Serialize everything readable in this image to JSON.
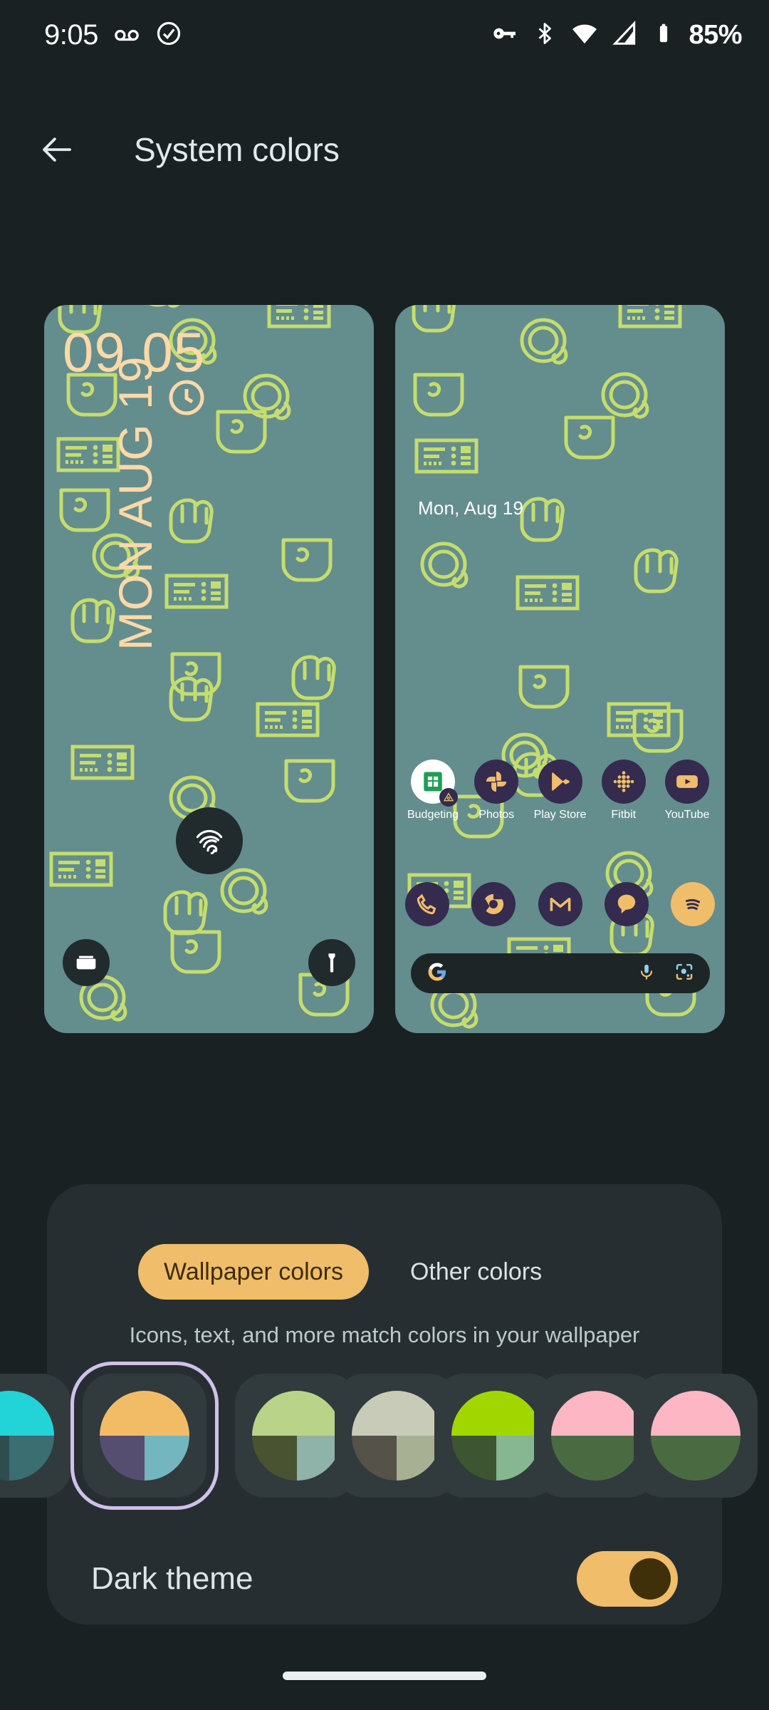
{
  "status_bar": {
    "time": "9:05",
    "battery_percent": "85%",
    "left_icons": [
      "voicemail-icon",
      "check-circle-icon"
    ],
    "right_icons": [
      "vpn-key-icon",
      "bluetooth-icon",
      "wifi-icon",
      "mobile-signal-icon",
      "battery-icon"
    ]
  },
  "app_bar": {
    "back_label": "Back",
    "title": "System colors"
  },
  "previews": {
    "lock_screen": {
      "clock": "09 05",
      "date_vertical": "MON AUG 19",
      "wallet_shortcut": "wallet-icon",
      "flashlight_shortcut": "flashlight-icon",
      "fingerprint": "fingerprint-icon",
      "wallpaper_bg": "#648d8d",
      "wallpaper_doodle": "#c5dd6e",
      "clock_color": "#ffd9a8"
    },
    "home_screen": {
      "date_widget": "Mon, Aug 19",
      "apps": [
        {
          "label": "Budgeting",
          "icon": "sheets-icon"
        },
        {
          "label": "Photos",
          "icon": "photos-icon"
        },
        {
          "label": "Play Store",
          "icon": "play-store-icon"
        },
        {
          "label": "Fitbit",
          "icon": "fitbit-icon"
        },
        {
          "label": "YouTube",
          "icon": "youtube-icon"
        }
      ],
      "dock": [
        {
          "label": "Phone",
          "icon": "phone-icon"
        },
        {
          "label": "Chrome",
          "icon": "chrome-icon"
        },
        {
          "label": "Gmail",
          "icon": "gmail-icon"
        },
        {
          "label": "Messages",
          "icon": "messages-icon"
        },
        {
          "label": "Spotify",
          "icon": "spotify-icon"
        }
      ],
      "search": {
        "placeholder": "",
        "leading_icon": "google-g-icon",
        "mic_icon": "microphone-icon",
        "lens_icon": "google-lens-icon"
      },
      "app_icon_bg": "#342b4e",
      "app_icon_fg": "#f0bd6a"
    }
  },
  "panel": {
    "tabs": [
      {
        "label": "Wallpaper colors",
        "selected": true
      },
      {
        "label": "Other colors",
        "selected": false
      }
    ],
    "description": "Icons, text, and more match colors in your wallpaper",
    "swatches": [
      {
        "name": "swatch-cyan",
        "selected": false,
        "top": "#22d3d8",
        "bottom_left": "#2f4c4e",
        "bottom_right": "#3a6e70",
        "partial": true
      },
      {
        "name": "swatch-amber",
        "selected": true,
        "top": "#f2bc67",
        "bottom_left": "#564e70",
        "bottom_right": "#74b6c0"
      },
      {
        "name": "swatch-green",
        "selected": false,
        "top": "#b9d489",
        "bottom_left": "#4a5331",
        "bottom_right": "#8fb2a9"
      },
      {
        "name": "swatch-greige",
        "selected": false,
        "top": "#c8cbb7",
        "bottom_left": "#545249",
        "bottom_right": "#a8b094"
      },
      {
        "name": "swatch-lime",
        "selected": false,
        "top": "#a2d600",
        "bottom_left": "#3d5531",
        "bottom_right": "#86b791"
      },
      {
        "name": "swatch-pink",
        "selected": false,
        "top": "#fcb6c4",
        "bottom_left": "#4a6b41",
        "bottom_right": "#4a6b41",
        "partial": true
      }
    ],
    "dark_theme": {
      "label": "Dark theme",
      "enabled": true,
      "track_color": "#f0bd6a",
      "thumb_color": "#40300a"
    }
  },
  "nav_bar": {
    "handle": "home-gesture-handle"
  }
}
